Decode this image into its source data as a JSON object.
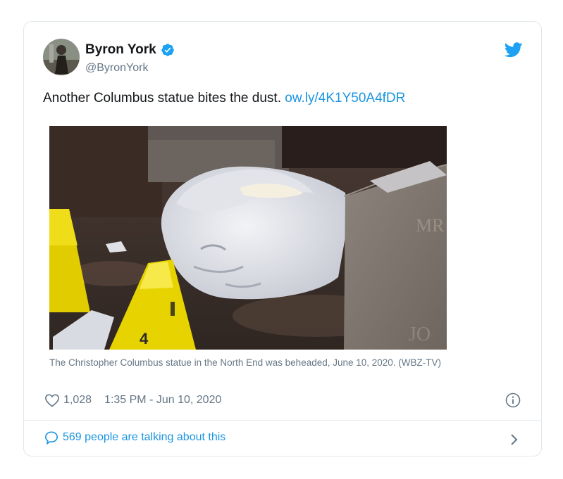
{
  "tweet": {
    "author_name": "Byron York",
    "author_handle": "@ByronYork",
    "text": "Another Columbus statue bites the dust.",
    "link": "ow.ly/4K1Y50A4fDR",
    "media_caption": "The Christopher Columbus statue in the North End was beheaded, June 10, 2020. (WBZ-TV)",
    "likes": "1,028",
    "timestamp": "1:35 PM - Jun 10, 2020",
    "talking": "569 people are talking about this"
  },
  "icons": {
    "verified": "verified-badge-icon",
    "twitter": "twitter-bird-icon",
    "like": "heart-icon",
    "info": "info-icon",
    "reply": "speech-bubble-icon",
    "chevron": "chevron-right-icon"
  },
  "colors": {
    "link": "#1b95e0",
    "muted": "#657786",
    "text": "#14171a",
    "border": "#e1e8ed"
  }
}
